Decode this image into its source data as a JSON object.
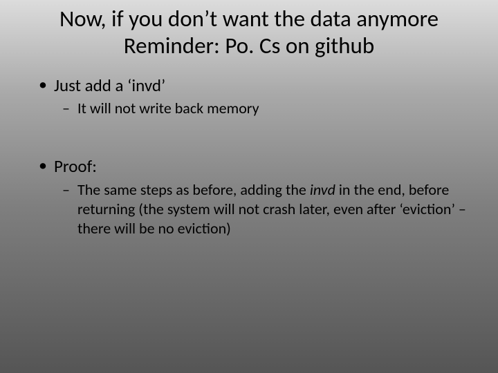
{
  "title_line1": "Now, if you don’t want the data anymore",
  "title_line2": "Reminder: Po. Cs on github",
  "bullet1": "Just add a ‘invd’",
  "bullet1_sub1": "It will not write back memory",
  "bullet2": "Proof:",
  "bullet2_sub1_pre": "The same steps as before, adding the ",
  "bullet2_sub1_em": "invd",
  "bullet2_sub1_post": " in the end, before returning (the system will not crash later, even after ‘eviction’ – there will be no eviction)"
}
